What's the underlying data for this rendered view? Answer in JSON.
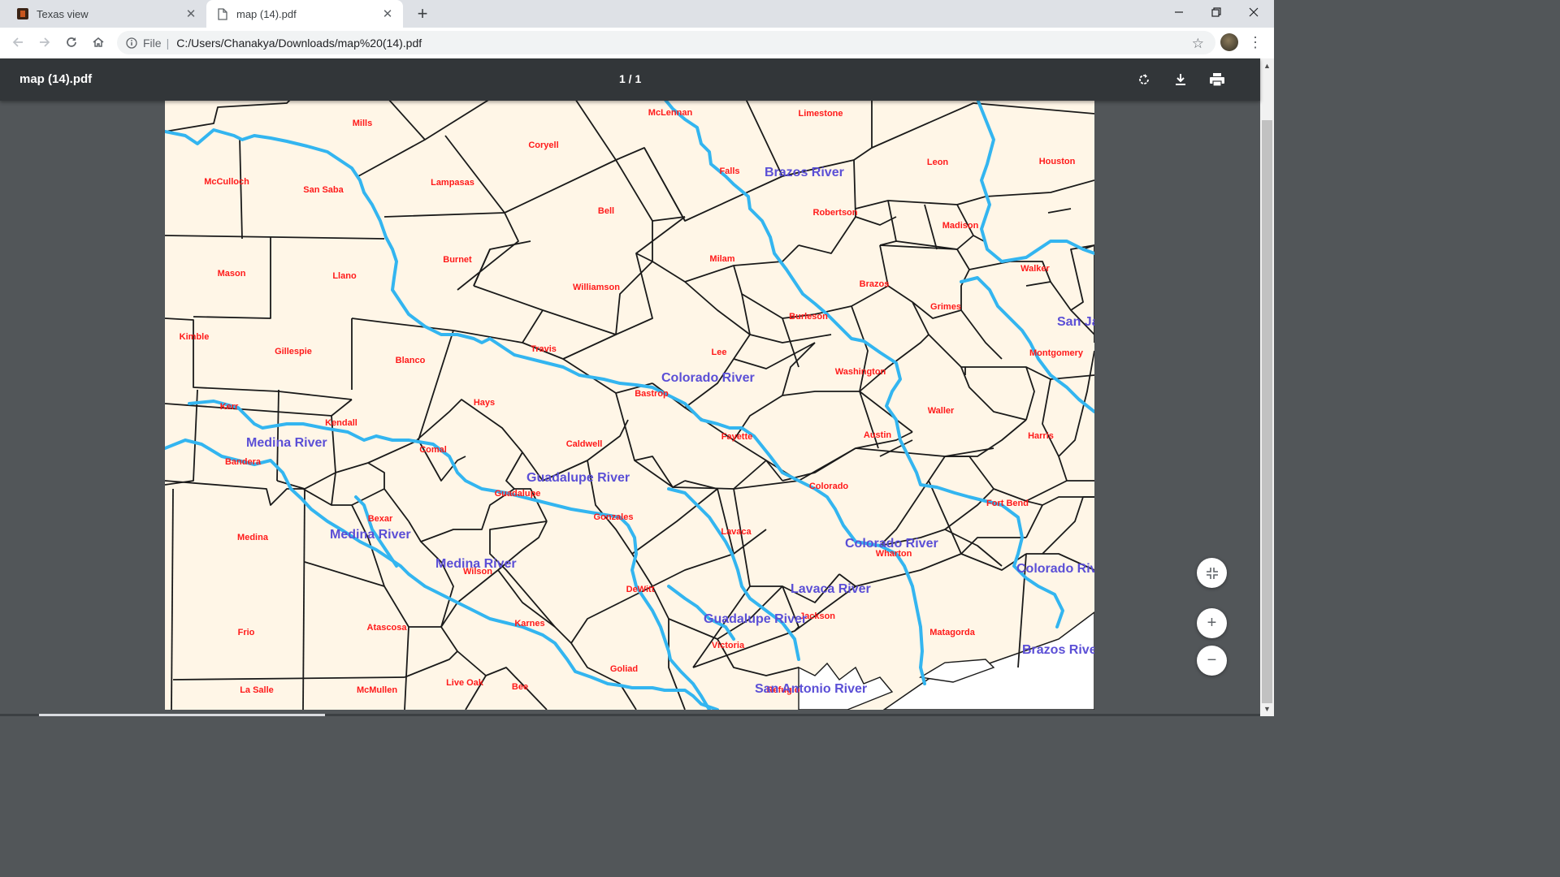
{
  "tabs": [
    {
      "title": "Texas view",
      "active": false
    },
    {
      "title": "map (14).pdf",
      "active": true
    }
  ],
  "address_bar": {
    "scheme_label": "File",
    "url": "C:/Users/Chanakya/Downloads/map%20(14).pdf"
  },
  "pdf_viewer": {
    "title": "map (14).pdf",
    "page_indicator": "1 / 1"
  },
  "map": {
    "county_labels": [
      "Mills",
      "Coryell",
      "McLennan",
      "Limestone",
      "McCulloch",
      "San Saba",
      "Lampasas",
      "Falls",
      "Leon",
      "Houston",
      "Bell",
      "Robertson",
      "Madison",
      "Burnet",
      "Mason",
      "Llano",
      "Milam",
      "Walker",
      "Williamson",
      "Brazos",
      "Grimes",
      "Kimble",
      "Gillespie",
      "Blanco",
      "Travis",
      "Burleson",
      "Lee",
      "Montgomery",
      "Washington",
      "Kerr",
      "Kendall",
      "Hays",
      "Bastrop",
      "Comal",
      "Caldwell",
      "Waller",
      "Austin",
      "Harris",
      "Bandera",
      "Guadalupe",
      "Fayette",
      "Colorado",
      "Fort Bend",
      "Bexar",
      "Gonzales",
      "Medina",
      "Lavaca",
      "Wharton",
      "Wilson",
      "DeWitt",
      "Frio",
      "Atascosa",
      "Karnes",
      "Jackson",
      "Victoria",
      "Matagorda",
      "Goliad",
      "Live Oak",
      "Bee",
      "La Salle",
      "McMullen",
      "Refugio"
    ],
    "river_labels": [
      "Brazos River",
      "Colorado River",
      "Medina River",
      "Guadalupe River",
      "San Jacinto",
      "Lavaca River",
      "San Antonio River"
    ],
    "colors": {
      "county_text": "#ff1a1a",
      "river_text": "#5b4fd6",
      "river_line": "#33b5f0",
      "background": "#fff6e7",
      "boundary": "#1a1a1a"
    }
  }
}
